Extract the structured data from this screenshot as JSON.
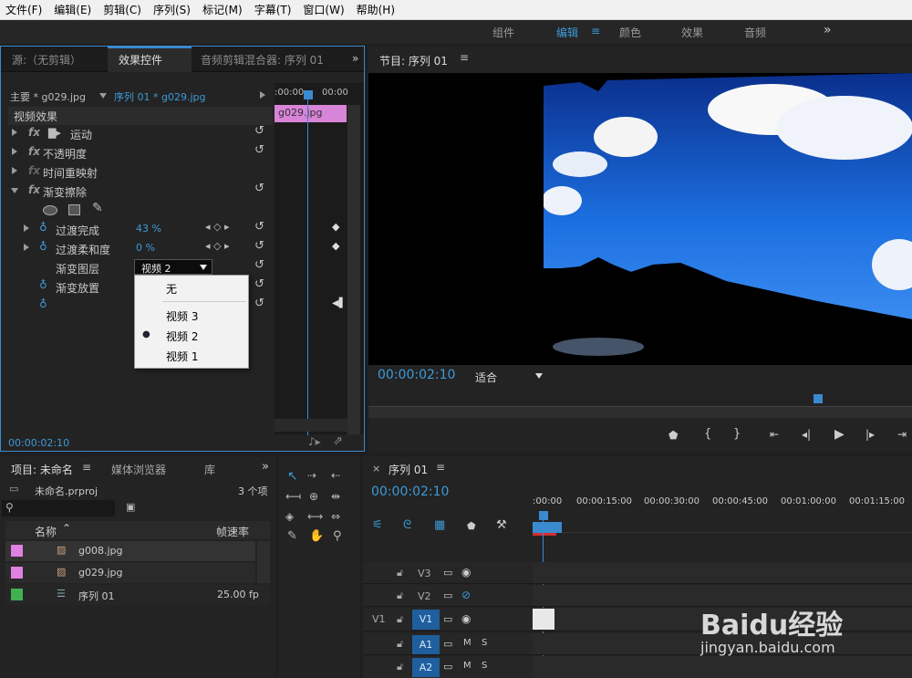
{
  "menu": [
    "文件(F)",
    "编辑(E)",
    "剪辑(C)",
    "序列(S)",
    "标记(M)",
    "字幕(T)",
    "窗口(W)",
    "帮助(H)"
  ],
  "workspaces": {
    "items": [
      "组件",
      "编辑",
      "颜色",
      "效果",
      "音频"
    ],
    "active": "编辑",
    "more": "»"
  },
  "effects_panel": {
    "tabs": [
      "源:（无剪辑）",
      "效果控件",
      "音频剪辑混合器: 序列 01"
    ],
    "master": "主要 * g029.jpg",
    "sequence": "序列 01 * g029.jpg",
    "ruler": [
      ":00:00",
      "00:00"
    ],
    "clip": "g029.jpg",
    "section": "视频效果",
    "effects": [
      "运动",
      "不透明度",
      "时间重映射",
      "渐变擦除"
    ],
    "params": [
      {
        "name": "过渡完成",
        "value": "43 %"
      },
      {
        "name": "过渡柔和度",
        "value": "0 %"
      }
    ],
    "layer_label": "渐变图层",
    "layer_value": "视频 2",
    "placement_label": "渐变放置",
    "dropdown": [
      "无",
      "视频 3",
      "视频 2",
      "视频 1"
    ],
    "dropdown_selected": "视频 2",
    "timecode": "00:00:02:10"
  },
  "program": {
    "title": "节目: 序列 01",
    "timecode": "00:00:02:10",
    "fit": "适合"
  },
  "project": {
    "tabs": [
      "项目: 未命名",
      "媒体浏览器",
      "库"
    ],
    "file": "未命名.prproj",
    "count": "3 个项",
    "col_name": "名称",
    "col_rate": "帧速率",
    "items": [
      {
        "name": "g008.jpg",
        "rate": "",
        "color": "#e080e0"
      },
      {
        "name": "g029.jpg",
        "rate": "",
        "color": "#e080e0"
      },
      {
        "name": "序列 01",
        "rate": "25.00 fp",
        "color": "#40b050"
      }
    ]
  },
  "sequence": {
    "title": "序列 01",
    "timecode": "00:00:02:10",
    "ruler": [
      ":00:00",
      "00:00:15:00",
      "00:00:30:00",
      "00:00:45:00",
      "00:01:00:00",
      "00:01:15:00"
    ],
    "tracks": [
      {
        "id": "V3",
        "src": "",
        "kind": "v"
      },
      {
        "id": "V2",
        "src": "",
        "kind": "v"
      },
      {
        "id": "V1",
        "src": "V1",
        "kind": "v"
      },
      {
        "id": "A1",
        "src": "",
        "kind": "a"
      },
      {
        "id": "A2",
        "src": "",
        "kind": "a"
      }
    ]
  },
  "watermark": {
    "text": "Baidu经验",
    "url": "jingyan.baidu.com"
  }
}
